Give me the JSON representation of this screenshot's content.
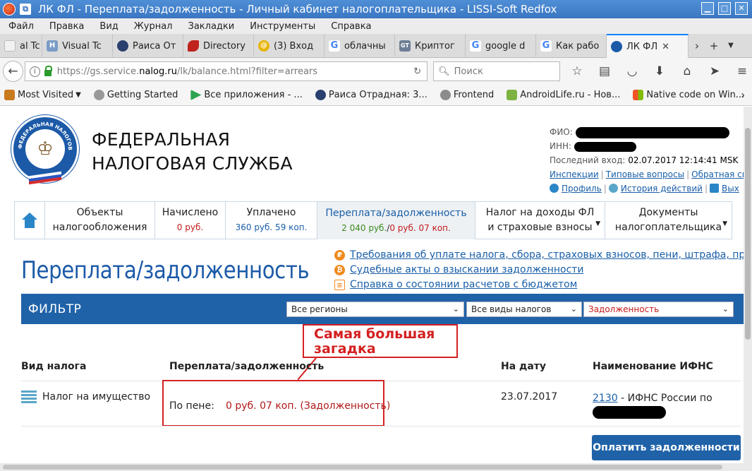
{
  "browser": {
    "window_title": "ЛК ФЛ - Переплата/задолженность - Личный кабинет налогоплательщика - LISSI-Soft Redfox",
    "menu": [
      "Файл",
      "Правка",
      "Вид",
      "Журнал",
      "Закладки",
      "Инструменты",
      "Справка"
    ],
    "tabs": [
      {
        "label": "al Tc",
        "icon_color": "#f2f2f2"
      },
      {
        "label": "Visual Tc",
        "icon_color": "#7a9cc6"
      },
      {
        "label": "Раиса От",
        "icon_color": "#2a3f6e"
      },
      {
        "label": "Directory",
        "icon_color": "#c0221d"
      },
      {
        "label": "(3) Вход",
        "icon_color": "#e7b400"
      },
      {
        "label": "облачны",
        "icon_color": "#4285f4"
      },
      {
        "label": "Криптог",
        "icon_color": "#6d7f95"
      },
      {
        "label": "google d",
        "icon_color": "#4285f4"
      },
      {
        "label": "Как рабо",
        "icon_color": "#4285f4"
      },
      {
        "label": "ЛК ФЛ",
        "icon_color": "#1c5aa8",
        "active": true
      }
    ],
    "url_prefix": "https://gs.service.",
    "url_domain": "nalog.ru",
    "url_rest": "/lk/balance.html?filter=arrears",
    "search_placeholder": "Поиск",
    "bookmarks": [
      {
        "label": "Most Visited",
        "icon_color": "#c87a1e",
        "has_menu": true
      },
      {
        "label": "Getting Started",
        "icon_color": "#999999"
      },
      {
        "label": "Все приложения - ...",
        "icon_color": "#2ea44f"
      },
      {
        "label": "Раиса Отрадная: 3...",
        "icon_color": "#2a3f6e"
      },
      {
        "label": "Frontend",
        "icon_color": "#8c8c8c"
      },
      {
        "label": "AndroidLife.ru - Нов...",
        "icon_color": "#7cb342"
      },
      {
        "label": "Native code on Win...",
        "icon_color": "#0078d7"
      }
    ]
  },
  "header": {
    "org_line1": "ФЕДЕРАЛЬНАЯ",
    "org_line2": "НАЛОГОВАЯ СЛУЖБА",
    "logo_text": "ФЕДЕРАЛЬНАЯ НАЛОГОВАЯ СЛУЖБА",
    "fio_label": "ФИО:",
    "inn_label": "ИНН:",
    "last_login_label": "Последний вход:",
    "last_login_value": "02.07.2017 12:14:41 MSK",
    "link_inspections": "Инспекции",
    "link_faq": "Типовые вопросы",
    "link_feedback": "Обратная свя",
    "link_profile": "Профиль",
    "link_history": "История действий",
    "link_exit": "Вых"
  },
  "nav": {
    "home": "home",
    "items": [
      {
        "line1": "Объекты",
        "line2": "налогообложения"
      },
      {
        "line1": "Начислено",
        "sub": "0 руб.",
        "sub_color": "#c21c1c"
      },
      {
        "line1": "Уплачено",
        "sub": "360 руб. 59 коп.",
        "sub_color": "#1a5fa8"
      },
      {
        "line1": "Переплата/задолженность",
        "sub_green": "2 040 руб.",
        "sub_sep": "/",
        "sub_red": "0 руб. 07 коп.",
        "active": true
      },
      {
        "line1": "Налог на доходы ФЛ",
        "line2": "и страховые взносы",
        "dropdown": true
      },
      {
        "line1": "Документы",
        "line2": "налогоплательщика",
        "dropdown": true
      }
    ]
  },
  "links": [
    {
      "icon": "₽",
      "text": "Требования об уплате налога, сбора, страховых взносов, пени, штрафа, процентов"
    },
    {
      "icon": "₿",
      "text": "Судебные акты о взыскании задолженности"
    },
    {
      "icon": "doc",
      "text": "Справка о состоянии расчетов с бюджетом"
    }
  ],
  "page_title": "Переплата/задолженность",
  "filter": {
    "label": "ФИЛЬТР",
    "region": "Все регионы",
    "tax_type": "Все виды налогов",
    "status": "Задолженность"
  },
  "annotation": {
    "line1": "Самая большая",
    "line2": "загадка"
  },
  "table": {
    "headers": [
      "Вид налога",
      "Переплата/задолженность",
      "На дату",
      "Наименование ИФНС"
    ],
    "rows": [
      {
        "tax": "Налог на имущество",
        "peni_label": "По пене:",
        "amount": "0 руб. 07 коп. (Задолженность)",
        "date": "23.07.2017",
        "ifns_code": "2130",
        "ifns_name": " - ИФНС России по"
      }
    ]
  },
  "pay_button": "Оплатить задолженности"
}
